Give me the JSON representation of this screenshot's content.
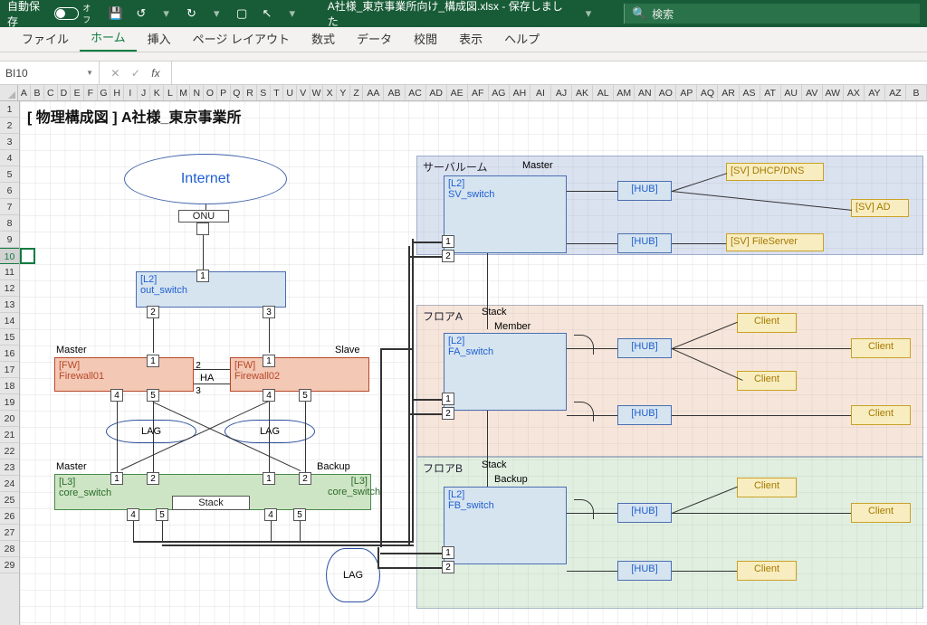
{
  "app": {
    "autosave_label": "自動保存",
    "autosave_state": "オフ",
    "filename": "A社様_東京事業所向け_構成図.xlsx - 保存しました",
    "search_placeholder": "検索"
  },
  "ribbon": {
    "file": "ファイル",
    "home": "ホーム",
    "insert": "挿入",
    "pagelayout": "ページ レイアウト",
    "formulas": "数式",
    "data": "データ",
    "review": "校閲",
    "view": "表示",
    "help": "ヘルプ"
  },
  "namebox": {
    "ref": "BI10"
  },
  "columns": [
    "A",
    "B",
    "C",
    "D",
    "E",
    "F",
    "G",
    "H",
    "I",
    "J",
    "K",
    "L",
    "M",
    "N",
    "O",
    "P",
    "Q",
    "R",
    "S",
    "T",
    "U",
    "V",
    "W",
    "X",
    "Y",
    "Z"
  ],
  "widecols": [
    "AA",
    "AB",
    "AC",
    "AD",
    "AE",
    "AF",
    "AG",
    "AH",
    "AI",
    "AJ",
    "AK",
    "AL",
    "AM",
    "AN",
    "AO",
    "AP",
    "AQ",
    "AR",
    "AS",
    "AT",
    "AU",
    "AV",
    "AW",
    "AX",
    "AY",
    "AZ",
    "B"
  ],
  "rows_visible": 29,
  "sheet_title": "[ 物理構成図 ] A社様_東京事業所",
  "labels": {
    "internet": "Internet",
    "onu": "ONU",
    "master": "Master",
    "slave": "Slave",
    "backup": "Backup",
    "ha": "HA",
    "lag": "LAG",
    "stack": "Stack",
    "stack_member": "Member",
    "stack_backup": "Backup",
    "server_room": "サーバルーム",
    "floor_a": "フロアA",
    "floor_b": "フロアB"
  },
  "devices": {
    "out_switch": {
      "tag": "[L2]",
      "name": "out_switch"
    },
    "fw1": {
      "tag": "[FW]",
      "name": "Firewall01"
    },
    "fw2": {
      "tag": "[FW]",
      "name": "Firewall02"
    },
    "core1": {
      "tag": "[L3]",
      "name": "core_switch"
    },
    "core2": {
      "tag": "[L3]",
      "name": "core_switch"
    },
    "sv_switch": {
      "tag": "[L2]",
      "name": "SV_switch"
    },
    "fa_switch": {
      "tag": "[L2]",
      "name": "FA_switch"
    },
    "fb_switch": {
      "tag": "[L2]",
      "name": "FB_switch"
    },
    "hub": "[HUB]",
    "sv_dhcp": "[SV] DHCP/DNS",
    "sv_ad": "[SV] AD",
    "sv_file": "[SV] FileServer",
    "client": "Client"
  },
  "ports": {
    "p1": "1",
    "p2": "2",
    "p3": "3",
    "p4": "4",
    "p5": "5"
  }
}
